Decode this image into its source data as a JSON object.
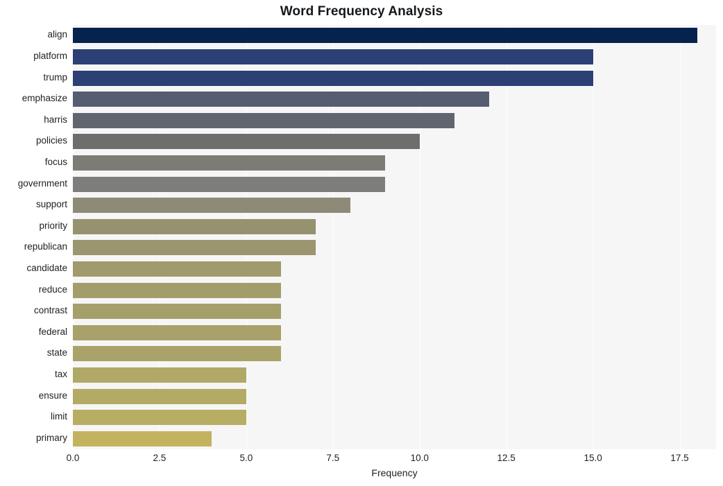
{
  "chart_data": {
    "type": "bar",
    "orientation": "horizontal",
    "title": "Word Frequency Analysis",
    "xlabel": "Frequency",
    "ylabel": "",
    "xlim": [
      0,
      18.55
    ],
    "xticks": [
      0.0,
      2.5,
      5.0,
      7.5,
      10.0,
      12.5,
      15.0,
      17.5
    ],
    "xtick_labels": [
      "0.0",
      "2.5",
      "5.0",
      "7.5",
      "10.0",
      "12.5",
      "15.0",
      "17.5"
    ],
    "grid": true,
    "grid_axis": "x",
    "legend": false,
    "categories": [
      "align",
      "platform",
      "trump",
      "emphasize",
      "harris",
      "policies",
      "focus",
      "government",
      "support",
      "priority",
      "republican",
      "candidate",
      "reduce",
      "contrast",
      "federal",
      "state",
      "tax",
      "ensure",
      "limit",
      "primary"
    ],
    "values": [
      18,
      15,
      15,
      12,
      11,
      10,
      9,
      9,
      8,
      7,
      7,
      6,
      6,
      6,
      6,
      6,
      5,
      5,
      5,
      4
    ],
    "bar_colors": [
      "#06234e",
      "#2b3c६8",
      "#2d4075",
      "#575d70",
      "#61656f",
      "#6e6e6d",
      "#7c7b76",
      "#7d7d7b",
      "#8d8a77",
      "#96916f",
      "#9b9570",
      "#a09a6c",
      "#a39d6b",
      "#a59f6b",
      "#a8a16a",
      "#aaa369",
      "#b0a866",
      "#b3ab65",
      "#b7ae63",
      "#c3b360"
    ],
    "plot_background": "#f6f6f7",
    "figure_background": "#ffffff"
  },
  "accessibility": {
    "figure_label": "Horizontal bar chart of word frequencies"
  }
}
